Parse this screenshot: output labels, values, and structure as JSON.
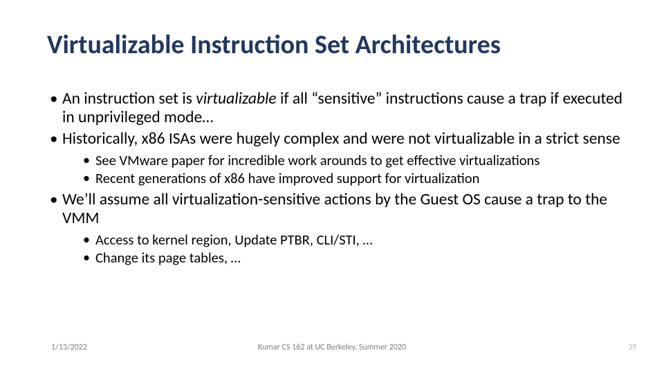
{
  "title": "Virtualizable Instruction Set Architectures",
  "bullets": {
    "b1_pre": "An instruction set is ",
    "b1_em": "virtualizable",
    "b1_post": " if all “sensitive” instructions cause a trap if executed in unprivileged mode…",
    "b2": "Historically, x86 ISAs were hugely complex and were not virtualizable in a strict sense",
    "b2_sub1": "See VMware paper for incredible work arounds to get effective virtualizations",
    "b2_sub2": "Recent generations of x86 have improved support for virtualization",
    "b3": "We’ll assume all virtualization-sensitive actions by the Guest OS cause a trap to the VMM",
    "b3_sub1": "Access to kernel region, Update PTBR, CLI/STI, …",
    "b3_sub2": "Change its page tables, …"
  },
  "footer": {
    "date": "1/13/2022",
    "center": "Kumar CS 162 at UC Berkeley, Summer 2020",
    "page": "39"
  }
}
